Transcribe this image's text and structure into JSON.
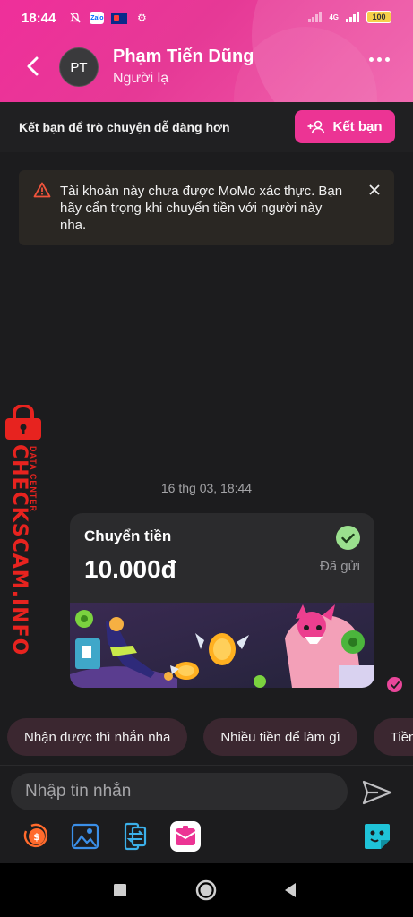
{
  "status_bar": {
    "time": "18:44",
    "zalo": "Zalo",
    "network": "4G",
    "battery": "100"
  },
  "header": {
    "avatar_initials": "PT",
    "contact_name": "Phạm Tiến Dũng",
    "contact_subtitle": "Người lạ"
  },
  "friend_bar": {
    "text": "Kết bạn để trò chuyện dễ dàng hơn",
    "button_label": "Kết bạn"
  },
  "warning": {
    "text": "Tài khoản này chưa được MoMo xác thực. Bạn hãy cẩn trọng khi chuyển tiền với người này nha."
  },
  "watermark": {
    "big": "CHECKSCAM.INFO",
    "small": "DATA CENTER"
  },
  "conversation": {
    "timestamp": "16 thg 03, 18:44"
  },
  "transfer_card": {
    "title": "Chuyển tiền",
    "amount": "10.000đ",
    "status": "Đã gửi"
  },
  "suggestions": [
    "Nhận được thì nhắn nha",
    "Nhiều tiền để làm gì",
    "Tiền"
  ],
  "composer": {
    "placeholder": "Nhập tin nhắn"
  },
  "colors": {
    "brand": "#ec3494",
    "check_green": "#9be08e",
    "warning_orange": "#f0543c"
  }
}
